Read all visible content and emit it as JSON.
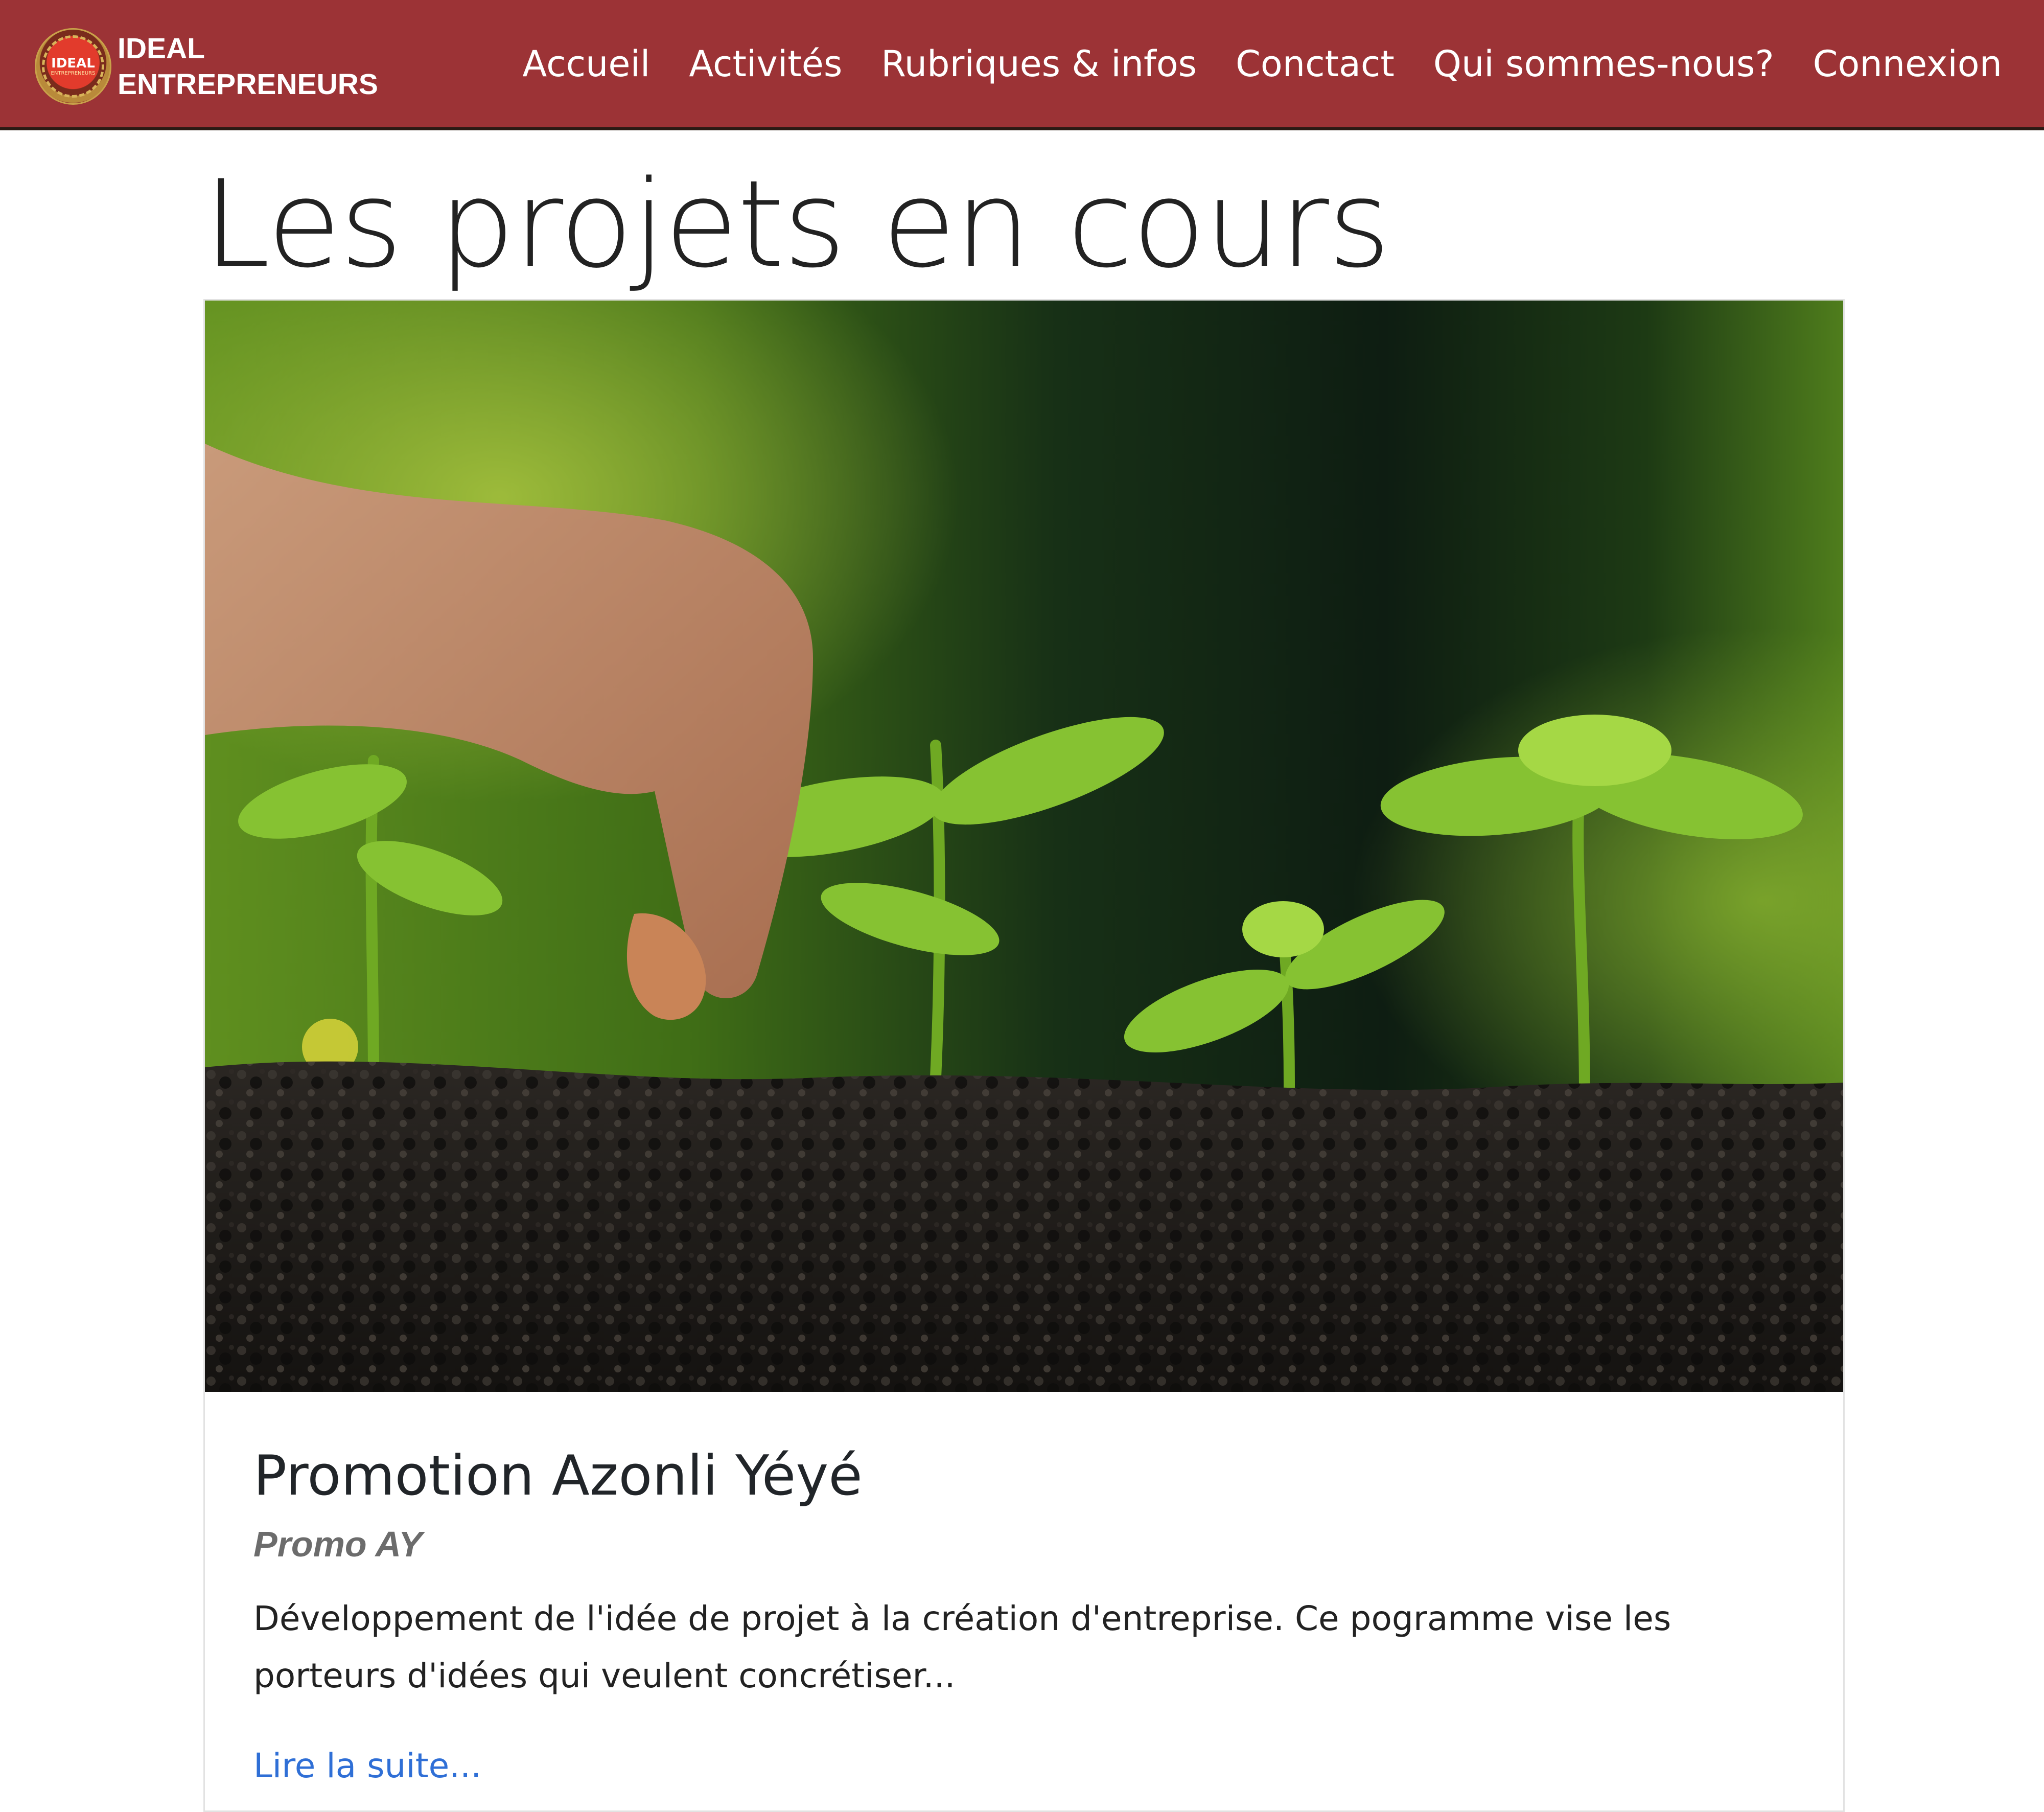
{
  "brand": {
    "logo_text": "IDEAL",
    "logo_subtext": "ENTREPRENEURS",
    "line1": "IDEAL",
    "line2": "ENTREPRENEURS"
  },
  "nav": {
    "items": [
      "Accueil",
      "Activités",
      "Rubriques & infos",
      "Conctact",
      "Qui sommes-nous?",
      "Connexion"
    ]
  },
  "page": {
    "title": "Les projets en cours"
  },
  "project_card": {
    "title": "Promotion Azonli Yéyé",
    "subtitle": "Promo AY",
    "description": "Développement de l'idée de projet à la création d'entreprise. Ce pogramme vise les porteurs d'idées qui veulent concrétiser...",
    "read_more": "Lire la suite..."
  },
  "colors": {
    "navbar": "#9c3336",
    "link": "#2f6fd6",
    "subtitle": "#6c6c6c"
  }
}
